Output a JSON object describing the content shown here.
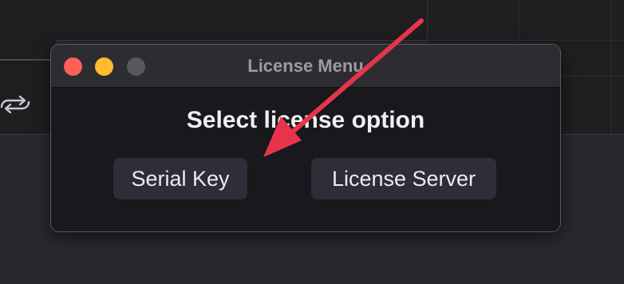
{
  "window": {
    "title": "License Menu",
    "heading": "Select license option"
  },
  "buttons": {
    "serial_key": "Serial Key",
    "license_server": "License Server"
  },
  "colors": {
    "close": "#fe5f57",
    "minimize": "#febc2e",
    "maximize_disabled": "#58575b",
    "annotation_arrow": "#e8344a"
  },
  "icons": {
    "background_icon": "repeat-icon",
    "annotation": "arrow-icon"
  }
}
